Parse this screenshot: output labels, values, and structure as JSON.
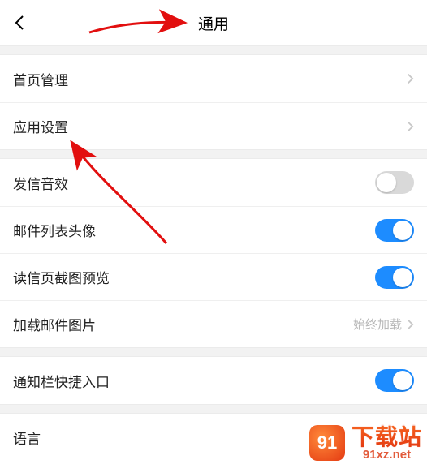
{
  "header": {
    "title": "通用"
  },
  "rows": {
    "home_management": "首页管理",
    "app_settings": "应用设置",
    "send_sound": "发信音效",
    "mail_list_avatar": "邮件列表头像",
    "read_preview": "读信页截图预览",
    "load_images": {
      "label": "加载邮件图片",
      "value": "始终加载"
    },
    "notification_shortcut": "通知栏快捷入口",
    "language": "语言"
  },
  "toggles": {
    "send_sound": false,
    "mail_list_avatar": true,
    "read_preview": true,
    "notification_shortcut": true
  },
  "watermark": {
    "brand": "下载站",
    "url": "91xz.net",
    "logo": "91"
  }
}
